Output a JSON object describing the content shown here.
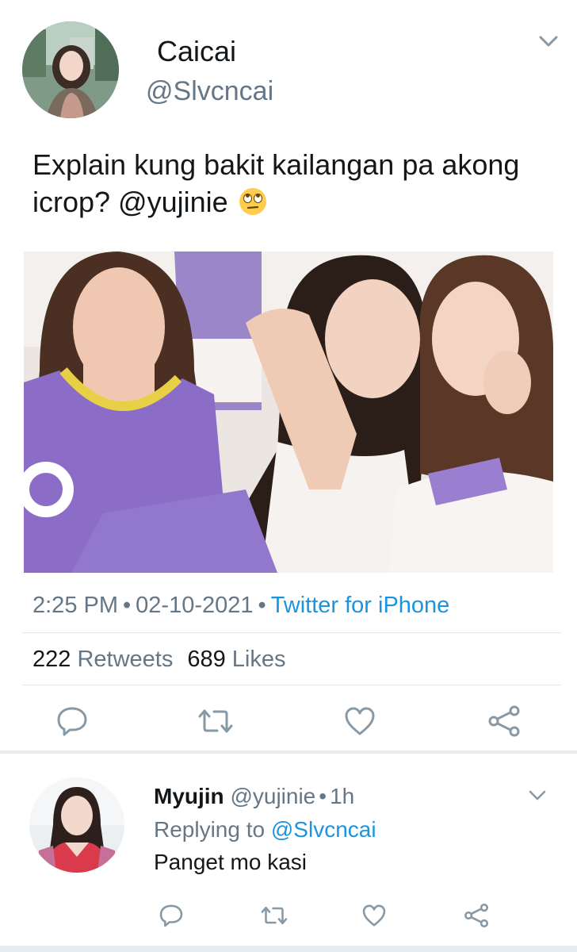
{
  "tweet": {
    "display_name": "Caicai",
    "handle": "@Slvcncai",
    "text": "Explain kung bakit kailangan pa akong icrop? @yujinie",
    "emoji": "eye-roll-emoji",
    "photo": "group-photo",
    "time": "2:25 PM",
    "date": "02-10-2021",
    "source": "Twitter for iPhone",
    "separator": "•",
    "retweets_count": "222",
    "retweets_label": "Retweets",
    "likes_count": "689",
    "likes_label": "Likes",
    "actions": [
      "reply-icon",
      "retweet-icon",
      "like-icon",
      "share-icon"
    ]
  },
  "reply": {
    "display_name": "Myujin",
    "handle": "@yujinie",
    "separator": "•",
    "time": "1h",
    "replying_prefix": "Replying to",
    "replying_to": "@Slvcncai",
    "text": "Panget mo kasi",
    "actions": [
      "reply-icon",
      "retweet-icon",
      "like-icon",
      "share-icon"
    ]
  },
  "colors": {
    "text": "#14171a",
    "secondary": "#657786",
    "link": "#1b95e0",
    "divider": "#e1e8ed",
    "icon": "#8899a6"
  }
}
